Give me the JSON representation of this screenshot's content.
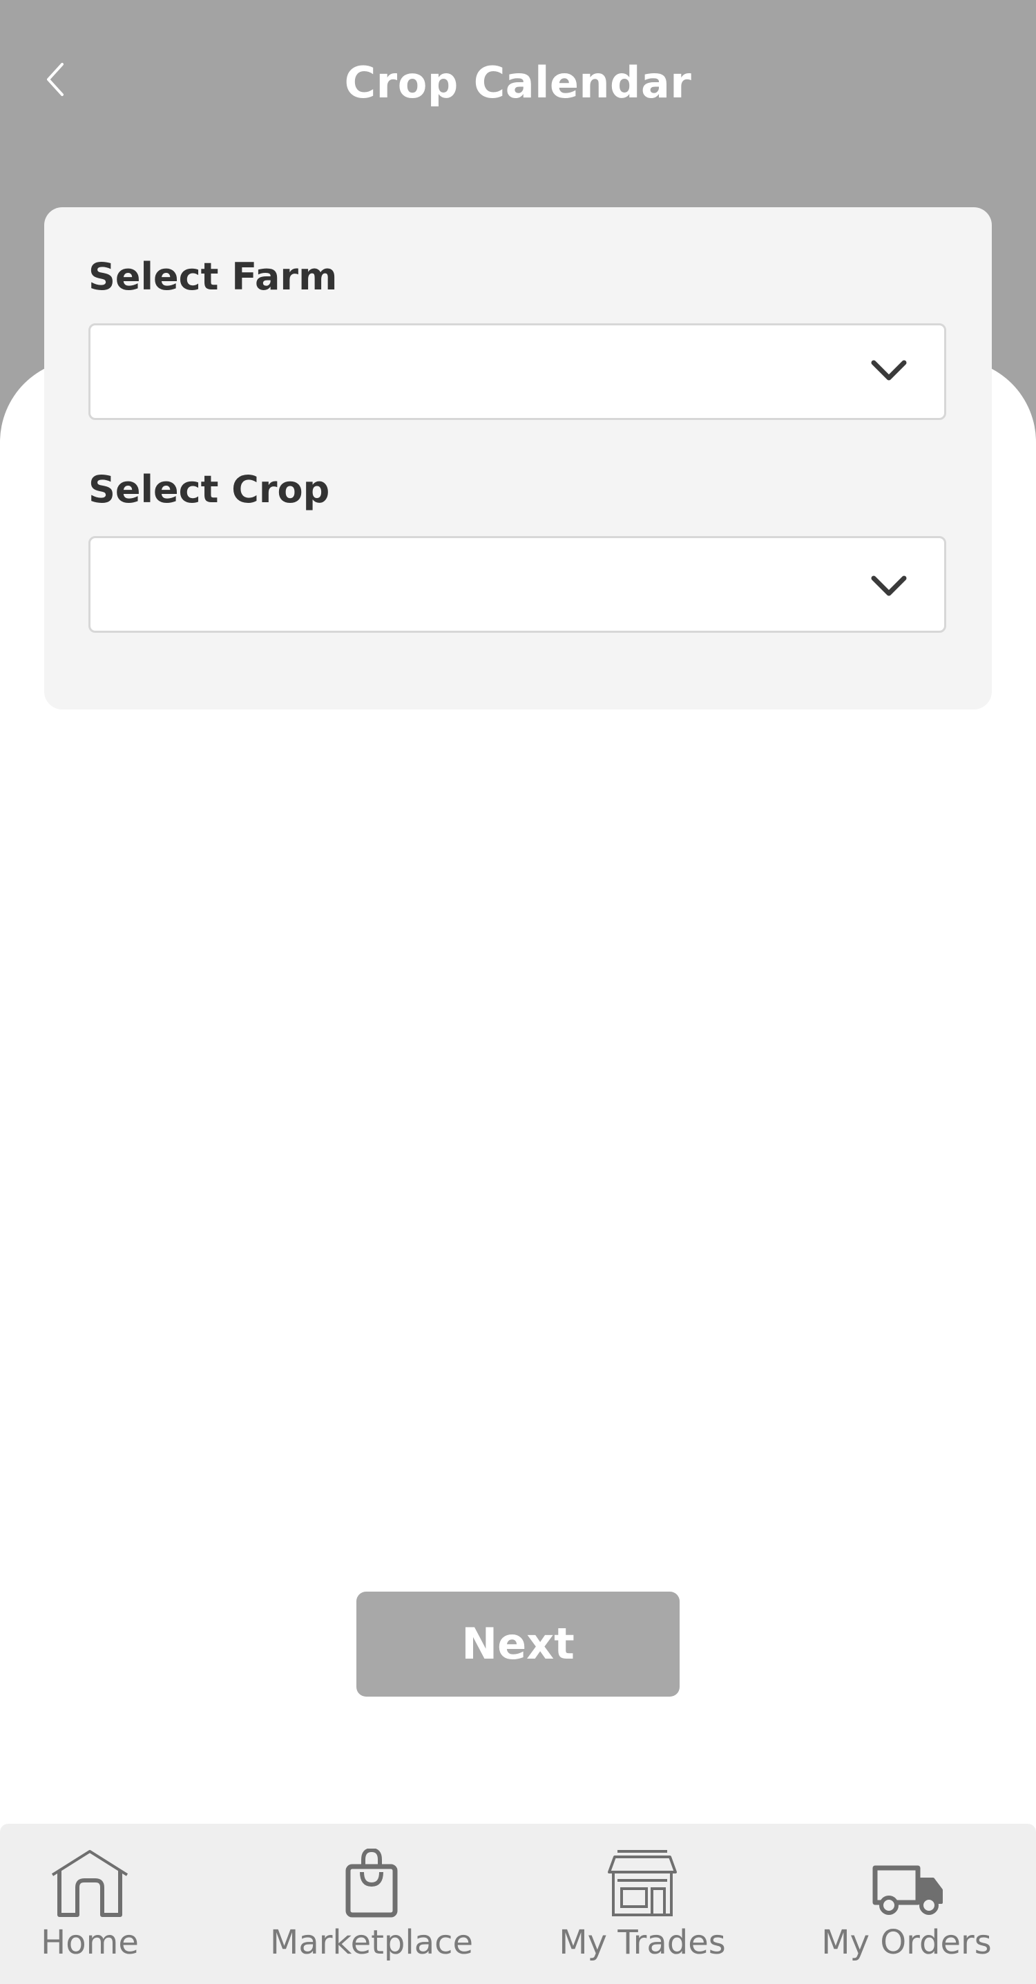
{
  "header": {
    "title": "Crop Calendar",
    "back_icon": "chevron-left-icon",
    "background_color": "#a3a3a3"
  },
  "form": {
    "farm_label": "Select Farm",
    "farm_value": "",
    "crop_label": "Select Crop",
    "crop_value": "",
    "dropdown_icon": "chevron-down-icon"
  },
  "actions": {
    "next_label": "Next",
    "button_color": "#a8a8a8"
  },
  "bottom_nav": {
    "items": [
      {
        "label": "Home",
        "icon": "home-icon"
      },
      {
        "label": "Marketplace",
        "icon": "shopping-bag-icon"
      },
      {
        "label": "My Trades",
        "icon": "storefront-icon"
      },
      {
        "label": "My Orders",
        "icon": "delivery-truck-icon"
      }
    ]
  }
}
